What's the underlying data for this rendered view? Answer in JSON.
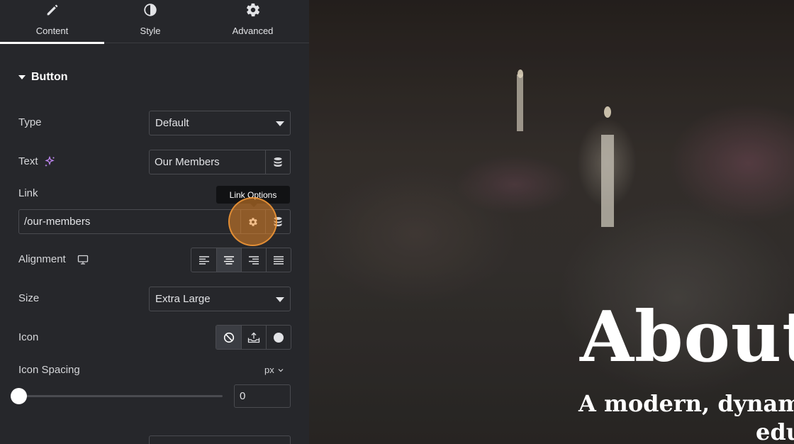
{
  "tabs": [
    {
      "label": "Content",
      "icon": "pencil-icon",
      "active": true
    },
    {
      "label": "Style",
      "icon": "half-circle-icon",
      "active": false
    },
    {
      "label": "Advanced",
      "icon": "gear-icon",
      "active": false
    }
  ],
  "section": {
    "title": "Button",
    "icon": "caret-down-icon"
  },
  "type": {
    "label": "Type",
    "value": "Default"
  },
  "text": {
    "label": "Text",
    "value": "Our Members",
    "ai_icon": "sparkle-icon",
    "dynamic_icon": "database-icon"
  },
  "link": {
    "label": "Link",
    "value": "/our-members",
    "tooltip": "Link Options",
    "options_icon": "gear-icon",
    "dynamic_icon": "database-icon"
  },
  "alignment": {
    "label": "Alignment",
    "device_icon": "desktop-icon",
    "options": [
      "left",
      "center",
      "right",
      "justify"
    ],
    "selected": "center"
  },
  "size": {
    "label": "Size",
    "value": "Extra Large"
  },
  "icon": {
    "label": "Icon",
    "options": [
      "none-icon",
      "upload-icon",
      "circle-icon"
    ],
    "selected": "none-icon"
  },
  "icon_spacing": {
    "label": "Icon Spacing",
    "unit": "px",
    "value": "0",
    "slider_fraction": 0
  },
  "preview": {
    "title": "About",
    "subtitle_line1": "A modern, dynamic",
    "subtitle_line2": "edu"
  },
  "colors": {
    "panel_bg": "#26272b",
    "highlight": "#e68728"
  }
}
